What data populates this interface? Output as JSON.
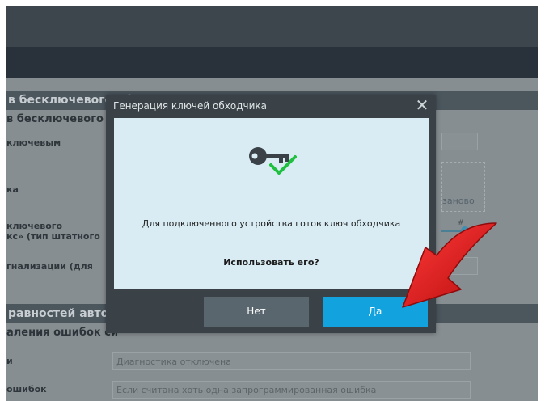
{
  "background": {
    "sections": [
      {
        "title": "в бесключевого обходчика"
      },
      {
        "title": "равностей автомо"
      }
    ],
    "subheadings": [
      "в бесключевого об",
      "аления ошибок си"
    ],
    "rows": [
      {
        "label": "ключевым"
      },
      {
        "label": "ка"
      },
      {
        "label": "ключевого\nкс» (тип штатного"
      },
      {
        "label": "гнализации (для"
      },
      {
        "label": "и"
      },
      {
        "label": "ошибок"
      }
    ],
    "link_text": "заново",
    "slider_marker": "#",
    "inputs": [
      {
        "value": "Диагностика отключена"
      },
      {
        "value": "Если считана хоть одна запрограммированная ошибка"
      }
    ]
  },
  "dialog": {
    "title": "Генерация ключей обходчика",
    "close_glyph": "✕",
    "message": "Для подключенного устройства готов ключ обходчика",
    "question": "Использовать его?",
    "no_label": "Нет",
    "yes_label": "Да",
    "icon": "key-check-icon"
  },
  "annotation": {
    "icon": "red-arrow-icon",
    "color": "#e02020"
  },
  "colors": {
    "accent": "#12a3de",
    "check": "#1fbf3f",
    "dialog_body": "#d9ecf4"
  }
}
